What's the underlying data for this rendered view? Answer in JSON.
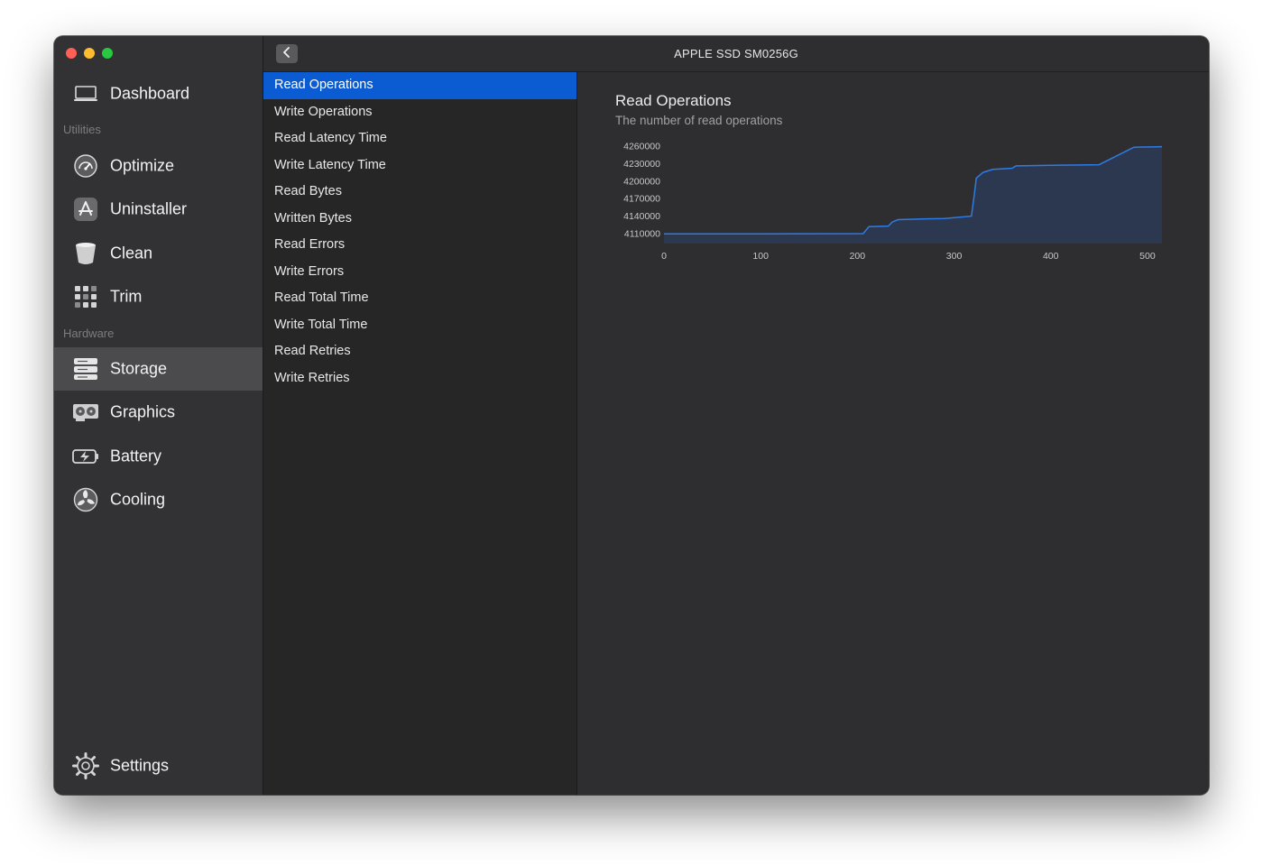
{
  "window": {
    "title": "APPLE SSD SM0256G"
  },
  "sidebar": {
    "top_item": {
      "label": "Dashboard",
      "icon": "laptop-icon"
    },
    "sections": [
      {
        "label": "Utilities"
      },
      {
        "label": "Hardware"
      }
    ],
    "items": [
      {
        "label": "Optimize",
        "icon": "gauge-icon"
      },
      {
        "label": "Uninstaller",
        "icon": "app-store-icon"
      },
      {
        "label": "Clean",
        "icon": "trash-bin-icon"
      },
      {
        "label": "Trim",
        "icon": "grid-icon"
      },
      {
        "label": "Storage",
        "icon": "server-icon",
        "active": true
      },
      {
        "label": "Graphics",
        "icon": "gpu-icon"
      },
      {
        "label": "Battery",
        "icon": "battery-icon"
      },
      {
        "label": "Cooling",
        "icon": "fan-icon"
      }
    ],
    "settings": {
      "label": "Settings",
      "icon": "gear-icon"
    }
  },
  "list": {
    "items": [
      "Read Operations",
      "Write Operations",
      "Read Latency Time",
      "Write Latency Time",
      "Read Bytes",
      "Written Bytes",
      "Read Errors",
      "Write Errors",
      "Read Total Time",
      "Write Total Time",
      "Read Retries",
      "Write Retries"
    ],
    "selected_index": 0
  },
  "detail": {
    "title": "Read Operations",
    "subtitle": "The number of read operations"
  },
  "colors": {
    "accent": "#0b5bd3",
    "line": "#2f7be6",
    "fill": "#2a3a55"
  },
  "chart_data": {
    "type": "area",
    "title": "",
    "xlabel": "",
    "ylabel": "",
    "xlim": [
      0,
      515
    ],
    "ylim": [
      4093000,
      4263000
    ],
    "x_ticks": [
      0,
      100,
      200,
      300,
      400,
      500
    ],
    "y_ticks": [
      4110000,
      4140000,
      4170000,
      4200000,
      4230000,
      4260000
    ],
    "x_tick_labels": [
      "0",
      "100",
      "200",
      "300",
      "400",
      "500"
    ],
    "y_tick_labels": [
      "4110000",
      "4140000",
      "4170000",
      "4200000",
      "4230000",
      "4260000"
    ],
    "grid": false,
    "legend": "none",
    "series": [
      {
        "points": [
          [
            0,
            4109500
          ],
          [
            100,
            4109700
          ],
          [
            150,
            4109900
          ],
          [
            206,
            4110000
          ],
          [
            212,
            4122000
          ],
          [
            232,
            4123000
          ],
          [
            236,
            4130000
          ],
          [
            242,
            4134000
          ],
          [
            265,
            4135000
          ],
          [
            290,
            4136000
          ],
          [
            318,
            4140000
          ],
          [
            321,
            4178000
          ],
          [
            323,
            4205000
          ],
          [
            330,
            4215000
          ],
          [
            340,
            4220000
          ],
          [
            360,
            4222000
          ],
          [
            364,
            4226000
          ],
          [
            400,
            4227000
          ],
          [
            450,
            4228000
          ],
          [
            486,
            4258000
          ],
          [
            515,
            4259000
          ]
        ]
      }
    ]
  }
}
